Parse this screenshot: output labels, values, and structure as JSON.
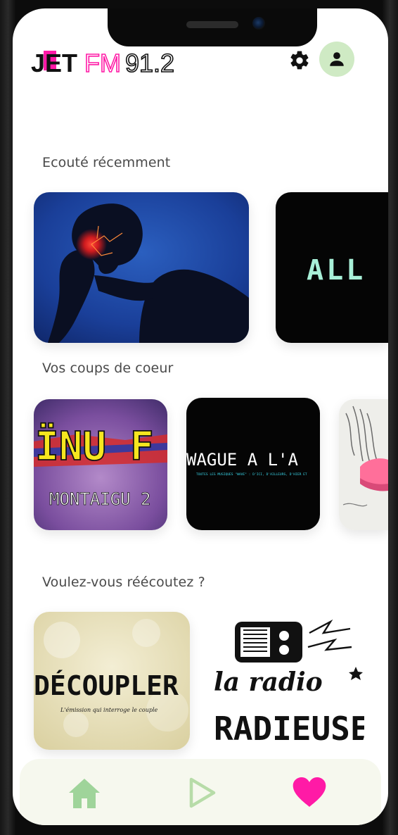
{
  "header": {
    "logo": {
      "part1": "JET",
      "part2": "FM",
      "part3": "91.2"
    },
    "settings_icon": "gear-icon",
    "account_icon": "user-icon"
  },
  "sections": {
    "recent": {
      "title": "Ecouté récemment",
      "items": [
        {
          "name": "headache-artwork"
        },
        {
          "name": "all-artwork",
          "text": "ALL"
        }
      ]
    },
    "favorites": {
      "title": "Vos coups de coeur",
      "items": [
        {
          "name": "inuf-montaigu-artwork",
          "text_top": "ÏNU F",
          "text_bottom": "MONTAIGU 2"
        },
        {
          "name": "vague-a-l-ame-artwork",
          "text_top": "WAGUE A L'A",
          "text_bottom": "TOUTES LES MUSIQUES \"WAVE\" : D'ICI, D'AILLEURS, D'HIER ET"
        },
        {
          "name": "illustration-artwork"
        }
      ]
    },
    "replay": {
      "title": "Voulez-vous réécoutez ?",
      "items": [
        {
          "name": "decoupler-artwork",
          "text_top": "DÉCOUPLER",
          "text_bottom": "L'émission qui interroge le couple"
        },
        {
          "name": "la-radio-radieuse-artwork",
          "text_top": "la radio",
          "text_bottom": "RADIEUSE"
        }
      ]
    }
  },
  "bottom_nav": {
    "home_icon": "home-icon",
    "play_icon": "play-icon",
    "favorites_icon": "heart-icon",
    "colors": {
      "home": "#9fd49a",
      "play": "#b7dca8",
      "heart": "#ff1aa6"
    }
  },
  "colors": {
    "accent_pink": "#ff1aa6",
    "avatar_bg": "#cfeac4",
    "section_text": "#4a4a4a"
  }
}
